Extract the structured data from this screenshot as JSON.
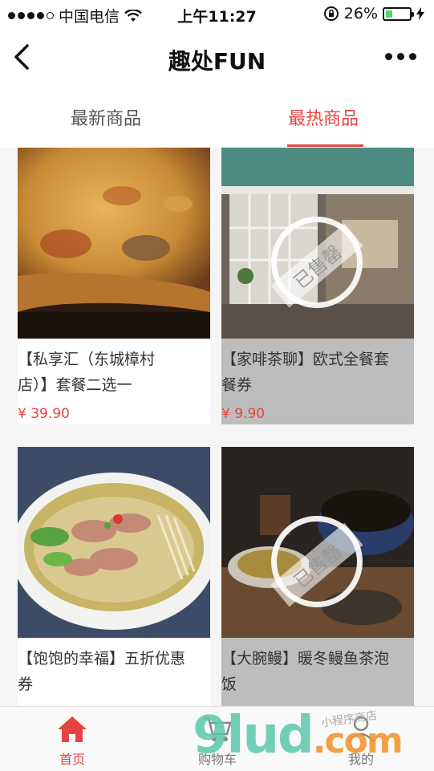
{
  "status_bar": {
    "carrier": "中国电信",
    "time": "上午11:27",
    "battery_percent": "26%",
    "battery_level": 0.26
  },
  "nav": {
    "title": "趣处FUN"
  },
  "tabs": [
    {
      "label": "最新商品",
      "active": false
    },
    {
      "label": "最热商品",
      "active": true
    }
  ],
  "products": [
    {
      "name_line1": "【私享汇（东城樟村",
      "name_line2": "店）】套餐二选一",
      "price": "¥ 39.90",
      "sold_out": false
    },
    {
      "name_line1": "【家啡茶聊】欧式全餐套",
      "name_line2": "餐券",
      "price": "¥ 9.90",
      "sold_out": true,
      "stamp_text": "已售罄"
    },
    {
      "name_line1": "【饱饱的幸福】五折优惠",
      "name_line2": "券",
      "price": "",
      "sold_out": false
    },
    {
      "name_line1": "【大腕鳗】暖冬鳗鱼茶泡",
      "name_line2": "饭",
      "price": "",
      "sold_out": true,
      "stamp_text": "已售罄"
    }
  ],
  "tabbar": [
    {
      "label": "首页",
      "icon": "home-icon",
      "active": true
    },
    {
      "label": "购物车",
      "icon": "cart-icon",
      "active": false
    },
    {
      "label": "我的",
      "icon": "user-icon",
      "active": false
    }
  ],
  "watermark": {
    "main": "9lud",
    "suffix": ".com",
    "small": "小程序商店"
  },
  "colors": {
    "accent": "#e64340",
    "battery": "#4cd964"
  }
}
